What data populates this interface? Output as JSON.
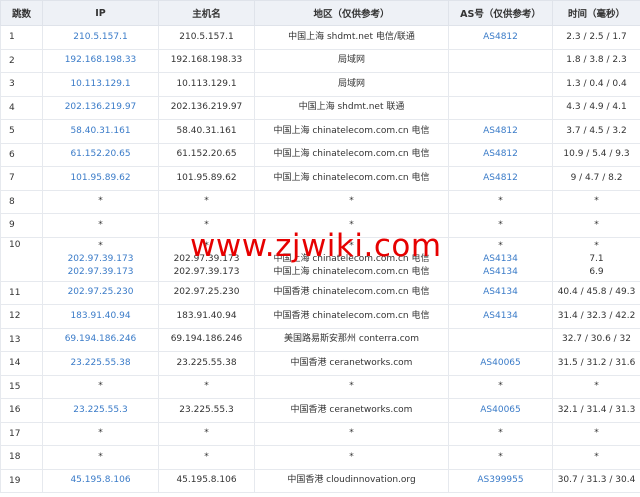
{
  "headers": [
    "跳数",
    "IP",
    "主机名",
    "地区（仅供参考）",
    "AS号（仅供参考）",
    "时间（毫秒）"
  ],
  "watermark": "www.zjwiki.com",
  "rows": [
    {
      "hop": "1",
      "ips": [
        "210.5.157.1"
      ],
      "hosts": [
        "210.5.157.1"
      ],
      "regions": [
        "中国上海 shdmt.net 电信/联通"
      ],
      "as": [
        "AS4812"
      ],
      "times": [
        "2.3 / 2.5 / 1.7"
      ]
    },
    {
      "hop": "2",
      "ips": [
        "192.168.198.33"
      ],
      "hosts": [
        "192.168.198.33"
      ],
      "regions": [
        "局域网"
      ],
      "as": [
        ""
      ],
      "times": [
        "1.8 / 3.8 / 2.3"
      ]
    },
    {
      "hop": "3",
      "ips": [
        "10.113.129.1"
      ],
      "hosts": [
        "10.113.129.1"
      ],
      "regions": [
        "局域网"
      ],
      "as": [
        ""
      ],
      "times": [
        "1.3 / 0.4 / 0.4"
      ]
    },
    {
      "hop": "4",
      "ips": [
        "202.136.219.97"
      ],
      "hosts": [
        "202.136.219.97"
      ],
      "regions": [
        "中国上海 shdmt.net 联通"
      ],
      "as": [
        ""
      ],
      "times": [
        "4.3 / 4.9 / 4.1"
      ]
    },
    {
      "hop": "5",
      "ips": [
        "58.40.31.161"
      ],
      "hosts": [
        "58.40.31.161"
      ],
      "regions": [
        "中国上海 chinatelecom.com.cn 电信"
      ],
      "as": [
        "AS4812"
      ],
      "times": [
        "3.7 / 4.5 / 3.2"
      ]
    },
    {
      "hop": "6",
      "ips": [
        "61.152.20.65"
      ],
      "hosts": [
        "61.152.20.65"
      ],
      "regions": [
        "中国上海 chinatelecom.com.cn 电信"
      ],
      "as": [
        "AS4812"
      ],
      "times": [
        "10.9 / 5.4 / 9.3"
      ]
    },
    {
      "hop": "7",
      "ips": [
        "101.95.89.62"
      ],
      "hosts": [
        "101.95.89.62"
      ],
      "regions": [
        "中国上海 chinatelecom.com.cn 电信"
      ],
      "as": [
        "AS4812"
      ],
      "times": [
        "9 / 4.7 / 8.2"
      ]
    },
    {
      "hop": "8",
      "ips": [
        "*"
      ],
      "hosts": [
        "*"
      ],
      "regions": [
        "*"
      ],
      "as": [
        "*"
      ],
      "times": [
        "*"
      ]
    },
    {
      "hop": "9",
      "ips": [
        "*"
      ],
      "hosts": [
        "*"
      ],
      "regions": [
        "*"
      ],
      "as": [
        "*"
      ],
      "times": [
        "*"
      ]
    },
    {
      "hop": "10",
      "ips": [
        "*",
        "202.97.39.173",
        "202.97.39.173"
      ],
      "hosts": [
        "*",
        "202.97.39.173",
        "202.97.39.173"
      ],
      "regions": [
        "*",
        "中国上海 chinatelecom.com.cn 电信",
        "中国上海 chinatelecom.com.cn 电信"
      ],
      "as": [
        "*",
        "AS4134",
        "AS4134"
      ],
      "times": [
        "*",
        "7.1",
        "6.9"
      ]
    },
    {
      "hop": "11",
      "ips": [
        "202.97.25.230"
      ],
      "hosts": [
        "202.97.25.230"
      ],
      "regions": [
        "中国香港 chinatelecom.com.cn 电信"
      ],
      "as": [
        "AS4134"
      ],
      "times": [
        "40.4 / 45.8 / 49.3"
      ]
    },
    {
      "hop": "12",
      "ips": [
        "183.91.40.94"
      ],
      "hosts": [
        "183.91.40.94"
      ],
      "regions": [
        "中国香港 chinatelecom.com.cn 电信"
      ],
      "as": [
        "AS4134"
      ],
      "times": [
        "31.4 / 32.3 / 42.2"
      ]
    },
    {
      "hop": "13",
      "ips": [
        "69.194.186.246"
      ],
      "hosts": [
        "69.194.186.246"
      ],
      "regions": [
        "美国路易斯安那州 conterra.com"
      ],
      "as": [
        ""
      ],
      "times": [
        "32.7 / 30.6 / 32"
      ]
    },
    {
      "hop": "14",
      "ips": [
        "23.225.55.38"
      ],
      "hosts": [
        "23.225.55.38"
      ],
      "regions": [
        "中国香港 ceranetworks.com"
      ],
      "as": [
        "AS40065"
      ],
      "times": [
        "31.5 / 31.2 / 31.6"
      ]
    },
    {
      "hop": "15",
      "ips": [
        "*"
      ],
      "hosts": [
        "*"
      ],
      "regions": [
        "*"
      ],
      "as": [
        "*"
      ],
      "times": [
        "*"
      ]
    },
    {
      "hop": "16",
      "ips": [
        "23.225.55.3"
      ],
      "hosts": [
        "23.225.55.3"
      ],
      "regions": [
        "中国香港 ceranetworks.com"
      ],
      "as": [
        "AS40065"
      ],
      "times": [
        "32.1 / 31.4 / 31.3"
      ]
    },
    {
      "hop": "17",
      "ips": [
        "*"
      ],
      "hosts": [
        "*"
      ],
      "regions": [
        "*"
      ],
      "as": [
        "*"
      ],
      "times": [
        "*"
      ]
    },
    {
      "hop": "18",
      "ips": [
        "*"
      ],
      "hosts": [
        "*"
      ],
      "regions": [
        "*"
      ],
      "as": [
        "*"
      ],
      "times": [
        "*"
      ]
    },
    {
      "hop": "19",
      "ips": [
        "45.195.8.106"
      ],
      "hosts": [
        "45.195.8.106"
      ],
      "regions": [
        "中国香港 cloudinnovation.org"
      ],
      "as": [
        "AS399955"
      ],
      "times": [
        "30.7 / 31.3 / 30.4"
      ]
    }
  ]
}
